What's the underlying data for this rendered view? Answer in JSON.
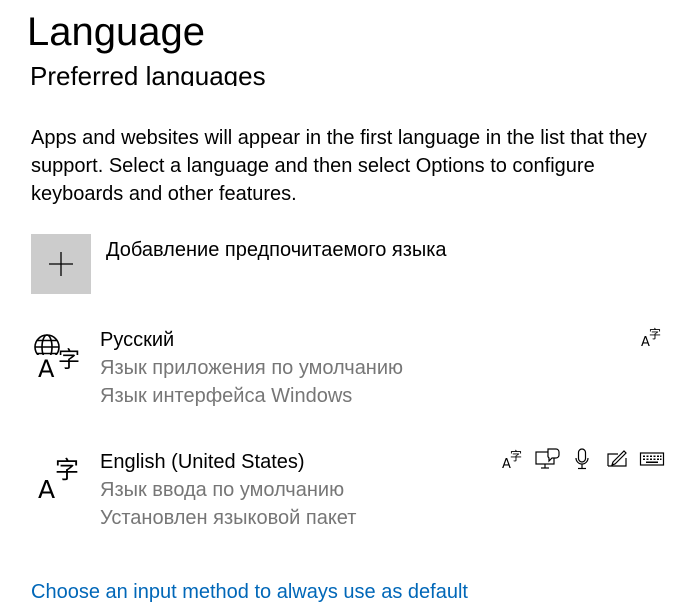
{
  "page": {
    "title": "Language",
    "section_title": "Preferred languages",
    "description": "Apps and websites will appear in the first language in the list that they support. Select a language and then select Options to configure keyboards and other features."
  },
  "add_language": {
    "icon": "plus-icon",
    "label": "Добавление предпочитаемого языка"
  },
  "languages": [
    {
      "name": "Русский",
      "details": [
        "Язык приложения по умолчанию",
        "Язык интерфейса Windows"
      ],
      "icon": "globe-language-icon",
      "features": [
        "language-pack-icon"
      ]
    },
    {
      "name": "English (United States)",
      "details": [
        "Язык ввода по умолчанию",
        "Установлен языковой пакет"
      ],
      "icon": "language-icon",
      "features": [
        "language-pack-icon",
        "text-to-speech-icon",
        "speech-recognition-icon",
        "handwriting-icon",
        "keyboard-icon"
      ]
    }
  ],
  "footer_link": "Choose an input method to always use as default",
  "colors": {
    "accent_link": "#0067b8",
    "secondary_text": "#767676",
    "tile_background": "#cccccc"
  }
}
